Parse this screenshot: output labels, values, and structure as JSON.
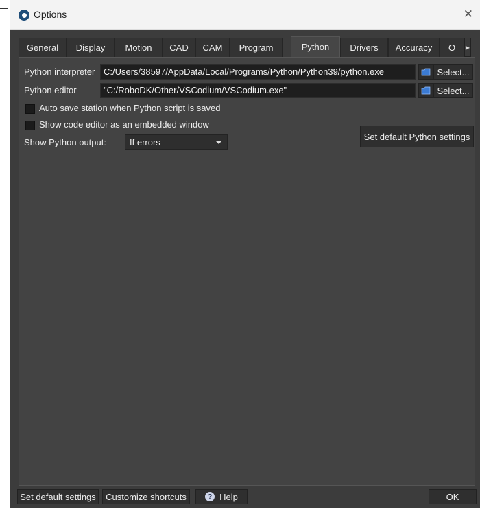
{
  "window": {
    "title": "Options",
    "close_glyph": "✕"
  },
  "tabs": [
    {
      "label": "General"
    },
    {
      "label": "Display"
    },
    {
      "label": "Motion"
    },
    {
      "label": "CAD"
    },
    {
      "label": "CAM"
    },
    {
      "label": "Program"
    },
    {
      "label": "Python",
      "active": true
    },
    {
      "label": "Drivers"
    },
    {
      "label": "Accuracy"
    },
    {
      "label": "O"
    }
  ],
  "tab_scroll_glyph": "▶",
  "python": {
    "interpreter_label": "Python interpreter",
    "interpreter_value": "C:/Users/38597/AppData/Local/Programs/Python/Python39/python.exe",
    "editor_label": "Python editor",
    "editor_value": "\"C:/RoboDK/Other/VSCodium/VSCodium.exe\"",
    "select_label": "Select...",
    "autosave_label": "Auto save station when Python script is saved",
    "autosave_checked": false,
    "embedded_label": "Show code editor as an embedded window",
    "embedded_checked": false,
    "output_label": "Show Python output:",
    "output_value": "If errors",
    "set_default_python_label": "Set default Python settings"
  },
  "bottom": {
    "set_default_settings": "Set default settings",
    "customize_shortcuts": "Customize shortcuts",
    "help": "Help",
    "ok": "OK"
  },
  "colors": {
    "window_bg": "#3c3c3c",
    "panel_bg": "#434343",
    "field_bg": "#1e1e1e",
    "titlebar_bg": "#f3f3f3",
    "folder_icon": "#3b7bd4"
  }
}
